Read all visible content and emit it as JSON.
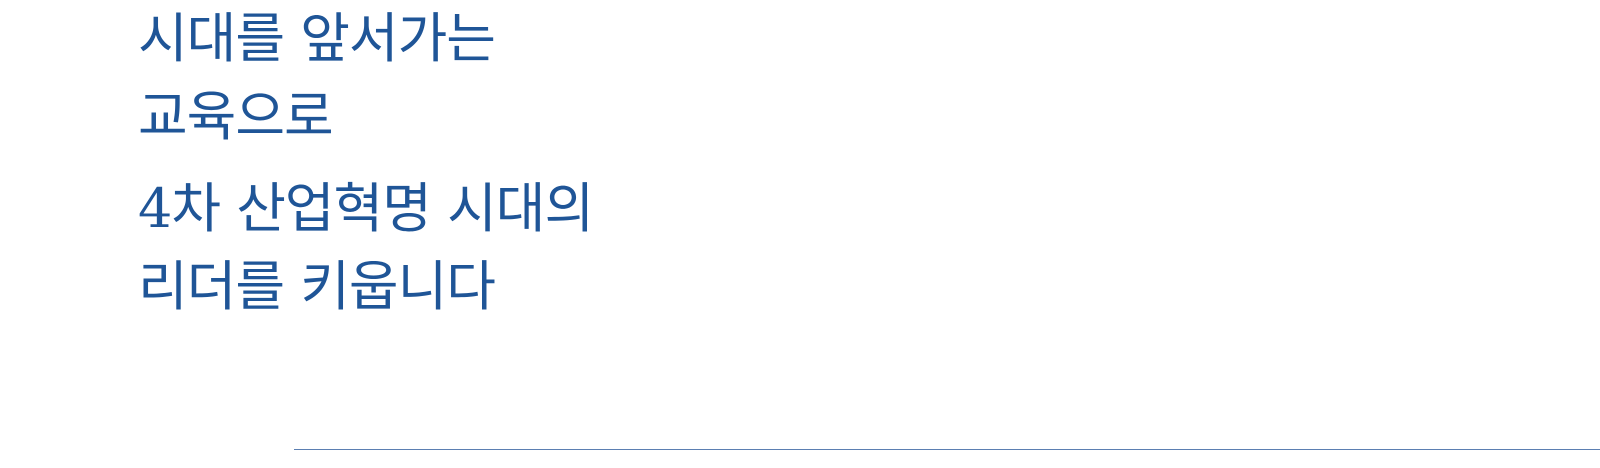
{
  "hero": {
    "headline": {
      "line1": "시대를 앞서가는",
      "line2": "교육으로"
    },
    "subheadline": {
      "line1": "4차 산업혁명 시대의",
      "line2": "리더를 키웁니다"
    }
  },
  "colors": {
    "text": "#1f5597",
    "divider": "#5b7fb2",
    "background": "#ffffff"
  }
}
